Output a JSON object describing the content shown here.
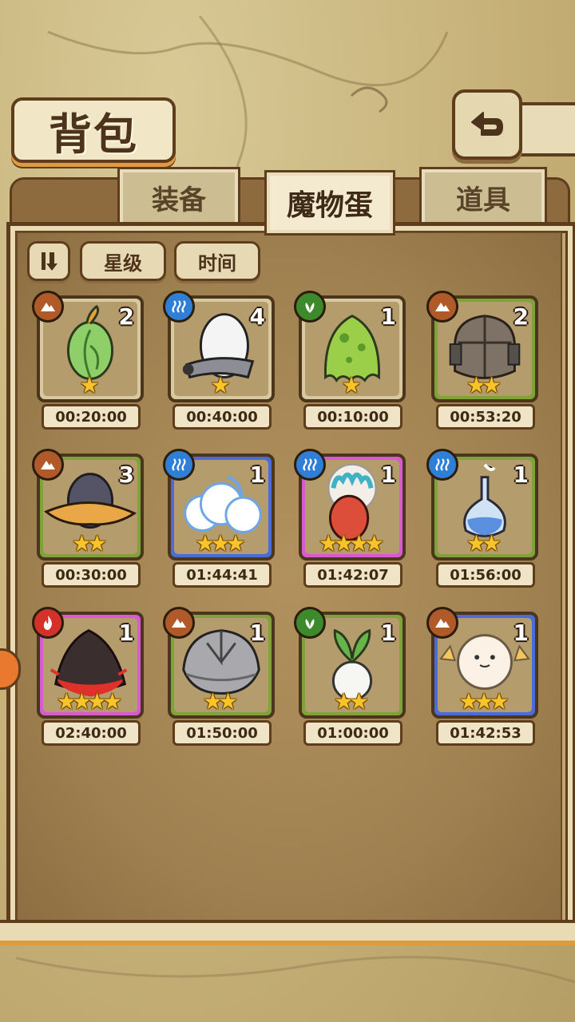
{
  "header": {
    "title": "背包"
  },
  "tabs": [
    {
      "label": "装备",
      "active": false
    },
    {
      "label": "魔物蛋",
      "active": true
    },
    {
      "label": "道具",
      "active": false
    }
  ],
  "sort": {
    "star_label": "星级",
    "time_label": "时间"
  },
  "colors": {
    "earth": "#b05a2a",
    "water": "#2f7fd6",
    "wood": "#3d8a2c",
    "fire": "#d2322a",
    "green_frame": "#7fa23a",
    "blue_frame": "#4b6bd8",
    "pink_frame": "#d85ad2",
    "tan_frame": "#d8c9a0"
  },
  "eggs": [
    {
      "element": "earth",
      "count": "2",
      "stars": 1,
      "time": "00:20:00",
      "frame": "tan_frame",
      "art": "leaf"
    },
    {
      "element": "water",
      "count": "4",
      "stars": 1,
      "time": "00:40:00",
      "frame": "tan_frame",
      "art": "white"
    },
    {
      "element": "wood",
      "count": "1",
      "stars": 1,
      "time": "00:10:00",
      "frame": "tan_frame",
      "art": "slime"
    },
    {
      "element": "earth",
      "count": "2",
      "stars": 2,
      "time": "00:53:20",
      "frame": "green_frame",
      "art": "rock"
    },
    {
      "element": "earth",
      "count": "3",
      "stars": 2,
      "time": "00:30:00",
      "frame": "green_frame",
      "art": "hat"
    },
    {
      "element": "water",
      "count": "1",
      "stars": 3,
      "time": "01:44:41",
      "frame": "blue_frame",
      "art": "cloud"
    },
    {
      "element": "water",
      "count": "1",
      "stars": 4,
      "time": "01:42:07",
      "frame": "pink_frame",
      "art": "feather"
    },
    {
      "element": "water",
      "count": "1",
      "stars": 2,
      "time": "01:56:00",
      "frame": "green_frame",
      "art": "flask"
    },
    {
      "element": "fire",
      "count": "1",
      "stars": 4,
      "time": "02:40:00",
      "frame": "pink_frame",
      "art": "lava"
    },
    {
      "element": "earth",
      "count": "1",
      "stars": 2,
      "time": "01:50:00",
      "frame": "green_frame",
      "art": "shell"
    },
    {
      "element": "wood",
      "count": "1",
      "stars": 2,
      "time": "01:00:00",
      "frame": "green_frame",
      "art": "radish"
    },
    {
      "element": "earth",
      "count": "1",
      "stars": 3,
      "time": "01:42:53",
      "frame": "blue_frame",
      "art": "fluff"
    }
  ]
}
